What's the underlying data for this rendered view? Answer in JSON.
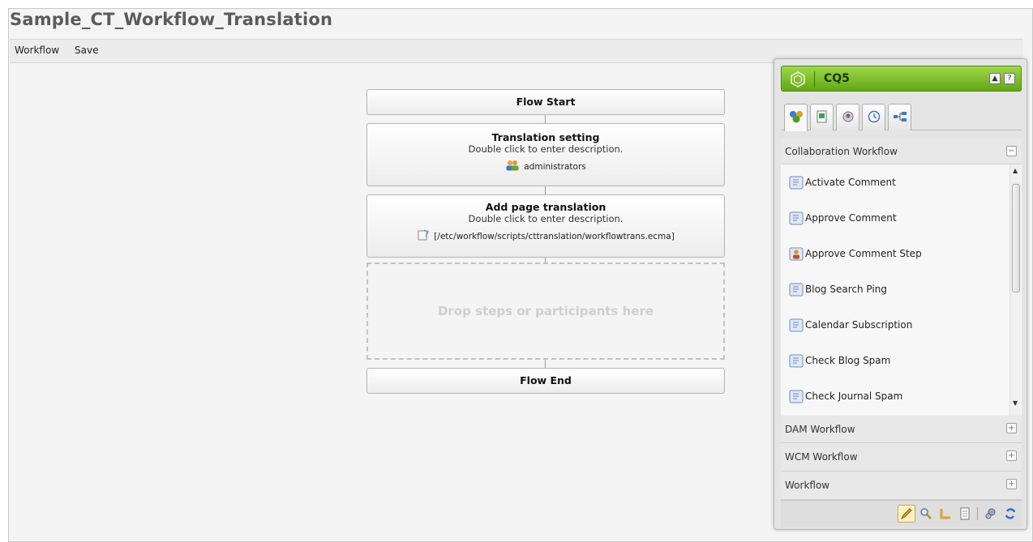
{
  "page": {
    "title": "Sample_CT_Workflow_Translation"
  },
  "menubar": {
    "workflow": "Workflow",
    "save": "Save"
  },
  "flow": {
    "start": "Flow Start",
    "steps": [
      {
        "title": "Translation setting",
        "description": "Double click to enter description.",
        "meta": "administrators",
        "meta_icon": "users-icon"
      },
      {
        "title": "Add page translation",
        "description": "Double click to enter description.",
        "meta": "[/etc/workflow/scripts/cttranslation/workflowtrans.ecma]",
        "meta_icon": "script-icon"
      }
    ],
    "drop_hint": "Drop steps or participants here",
    "end": "Flow End"
  },
  "sidekick": {
    "title": "CQ5",
    "brand_color": "#7bbf2a",
    "tabs": [
      "components-icon",
      "page-icon",
      "info-icon",
      "versions-icon",
      "workflow-icon"
    ],
    "groups": [
      {
        "name": "Collaboration Workflow",
        "expanded": true,
        "toggle": "−"
      },
      {
        "name": "DAM Workflow",
        "expanded": false,
        "toggle": "+"
      },
      {
        "name": "WCM Workflow",
        "expanded": false,
        "toggle": "+"
      },
      {
        "name": "Workflow",
        "expanded": false,
        "toggle": "+"
      }
    ],
    "items": [
      {
        "label": "Activate Comment",
        "icon": "process-step-icon"
      },
      {
        "label": "Approve Comment",
        "icon": "process-step-icon"
      },
      {
        "label": "Approve Comment Step",
        "icon": "participant-step-icon"
      },
      {
        "label": "Blog Search Ping",
        "icon": "process-step-icon"
      },
      {
        "label": "Calendar Subscription",
        "icon": "process-step-icon"
      },
      {
        "label": "Check Blog Spam",
        "icon": "process-step-icon"
      },
      {
        "label": "Check Journal Spam",
        "icon": "process-step-icon"
      }
    ],
    "footer_buttons": [
      "edit-mode-icon",
      "preview-icon",
      "design-icon",
      "properties-icon",
      "settings-icon",
      "refresh-icon"
    ]
  }
}
